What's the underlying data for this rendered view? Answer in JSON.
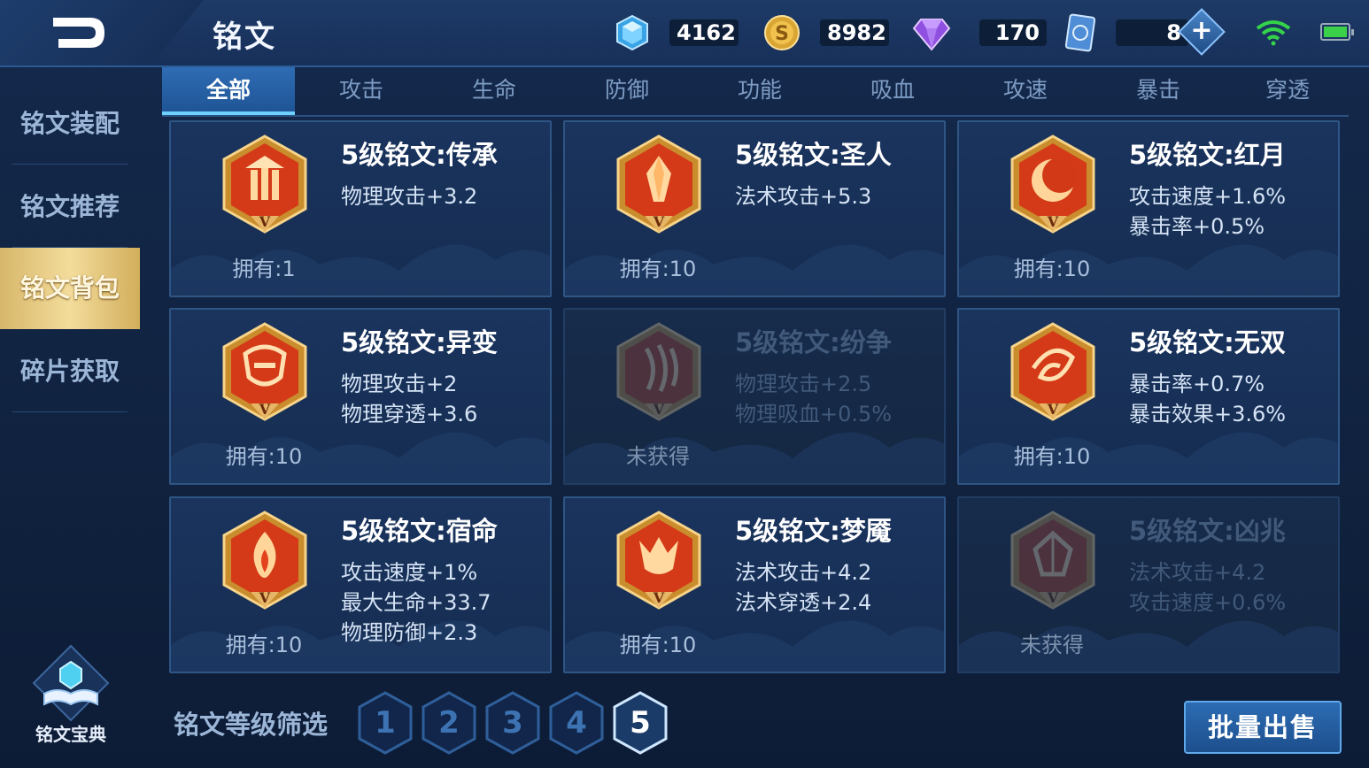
{
  "header": {
    "title": "铭文",
    "resources": [
      {
        "icon": "diamond-coin-icon",
        "value": "4162"
      },
      {
        "icon": "gold-coin-icon",
        "value": "8982"
      },
      {
        "icon": "purple-gem-icon",
        "value": "170"
      },
      {
        "icon": "card-ticket-icon",
        "value": "8"
      }
    ]
  },
  "sidebar": {
    "items": [
      {
        "label": "铭文装配"
      },
      {
        "label": "铭文推荐"
      },
      {
        "label": "铭文背包"
      },
      {
        "label": "碎片获取"
      }
    ],
    "active_index": 2,
    "codex_label": "铭文宝典"
  },
  "tabs": {
    "items": [
      "全部",
      "攻击",
      "生命",
      "防御",
      "功能",
      "吸血",
      "攻速",
      "暴击",
      "穿透"
    ],
    "active_index": 0
  },
  "cards": [
    {
      "name": "5级铭文:传承",
      "attrs": [
        "物理攻击+3.2"
      ],
      "owned": "拥有:1",
      "locked": false,
      "emblem": "pillar"
    },
    {
      "name": "5级铭文:圣人",
      "attrs": [
        "法术攻击+5.3"
      ],
      "owned": "拥有:10",
      "locked": false,
      "emblem": "crystal"
    },
    {
      "name": "5级铭文:红月",
      "attrs": [
        "攻击速度+1.6%",
        "暴击率+0.5%"
      ],
      "owned": "拥有:10",
      "locked": false,
      "emblem": "moon"
    },
    {
      "name": "5级铭文:异变",
      "attrs": [
        "物理攻击+2",
        "物理穿透+3.6"
      ],
      "owned": "拥有:10",
      "locked": false,
      "emblem": "mask"
    },
    {
      "name": "5级铭文:纷争",
      "attrs": [
        "物理攻击+2.5",
        "物理吸血+0.5%"
      ],
      "owned": "未获得",
      "locked": true,
      "emblem": "claw"
    },
    {
      "name": "5级铭文:无双",
      "attrs": [
        "暴击率+0.7%",
        "暴击效果+3.6%"
      ],
      "owned": "拥有:10",
      "locked": false,
      "emblem": "swirl"
    },
    {
      "name": "5级铭文:宿命",
      "attrs": [
        "攻击速度+1%",
        "最大生命+33.7",
        "物理防御+2.3"
      ],
      "owned": "拥有:10",
      "locked": false,
      "emblem": "flame"
    },
    {
      "name": "5级铭文:梦魇",
      "attrs": [
        "法术攻击+4.2",
        "法术穿透+2.4"
      ],
      "owned": "拥有:10",
      "locked": false,
      "emblem": "demon"
    },
    {
      "name": "5级铭文:凶兆",
      "attrs": [
        "法术攻击+4.2",
        "攻击速度+0.6%"
      ],
      "owned": "未获得",
      "locked": true,
      "emblem": "gem"
    }
  ],
  "footer": {
    "filter_label": "铭文等级筛选",
    "levels": [
      "1",
      "2",
      "3",
      "4",
      "5"
    ],
    "active_level_index": 4,
    "sell_label": "批量出售"
  }
}
